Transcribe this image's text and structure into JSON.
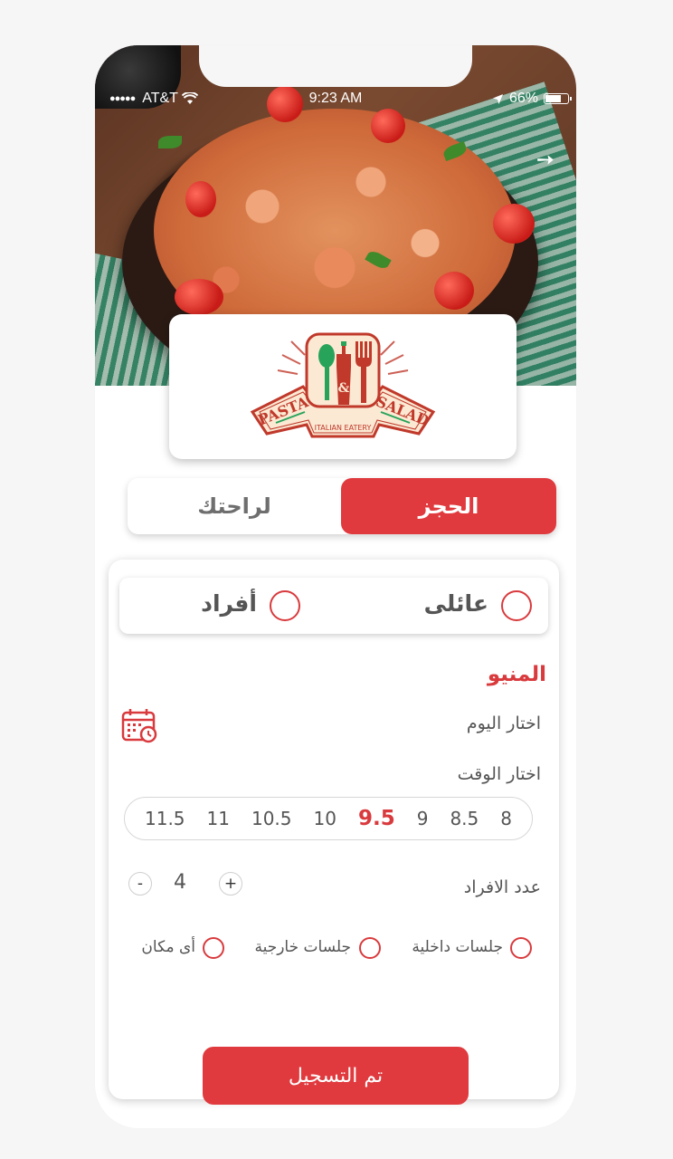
{
  "status_bar": {
    "signal": "●●●●●",
    "carrier": "AT&T",
    "wifi_icon": "wifi-icon",
    "time": "9:23 AM",
    "location_icon": "location-arrow-icon",
    "battery": "66%"
  },
  "hero": {
    "image": "pasta-dish-photo",
    "forward_icon": "arrow-right-icon"
  },
  "logo": {
    "line1_left": "PASTA",
    "line1_right": "SALAD",
    "ampersand": "&",
    "subtitle": "ITALIAN EATERY"
  },
  "tabs": [
    {
      "label": "الحجز",
      "active": true
    },
    {
      "label": "لراحتك",
      "active": false
    }
  ],
  "booking_type": {
    "options": [
      "عائلى",
      "أفراد"
    ]
  },
  "form": {
    "section_title": "المنيو",
    "choose_day": "اختار اليوم",
    "calendar_icon": "calendar-clock-icon",
    "choose_time": "اختار الوقت",
    "times": [
      "8",
      "8.5",
      "9",
      "9.5",
      "10",
      "10.5",
      "11",
      "11.5"
    ],
    "selected_time": "9.5",
    "people_label": "عدد الافراد",
    "people_count": "4",
    "plus": "+",
    "minus": "-",
    "seating": [
      "جلسات داخلية",
      "جلسات خارجية",
      "أى مكان"
    ],
    "submit_label": "تم التسجيل"
  },
  "colors": {
    "accent": "#e03a3e",
    "text": "#555555"
  }
}
